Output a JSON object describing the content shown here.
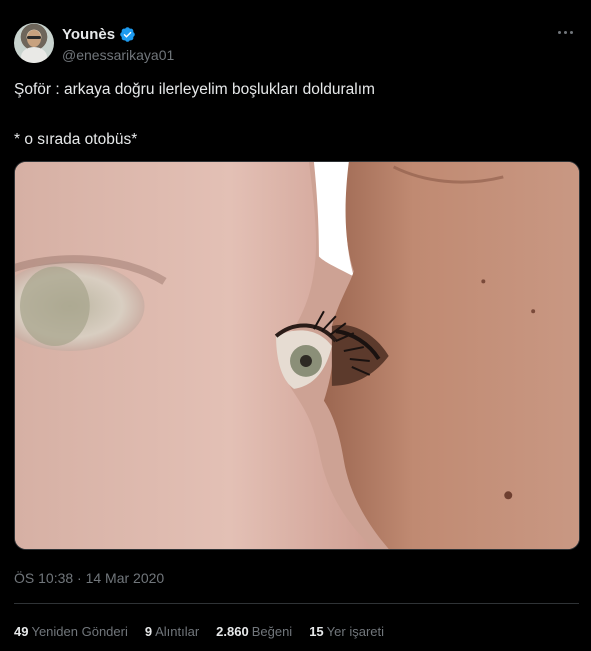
{
  "author": {
    "display_name": "Younès",
    "handle": "@enessarikaya01",
    "verified": true,
    "avatar_icon": "profile-photo",
    "verified_color": "#1d9bf0"
  },
  "menu_icon": "more-horizontal-icon",
  "tweet": {
    "line1": "Şoför : arkaya doğru ilerleyelim boşlukları dolduralım",
    "line2": "* o sırada otobüs*"
  },
  "media": {
    "kind": "photo"
  },
  "timestamp": "ÖS 10:38 · 14 Mar 2020",
  "stats": [
    {
      "count": "49",
      "label": "Yeniden Gönderi"
    },
    {
      "count": "9",
      "label": "Alıntılar"
    },
    {
      "count": "2.860",
      "label": "Beğeni"
    },
    {
      "count": "15",
      "label": "Yer işareti"
    }
  ],
  "colors": {
    "background": "#000000",
    "text": "#e7e9ea",
    "muted": "#71767b",
    "border": "#2f3336"
  }
}
